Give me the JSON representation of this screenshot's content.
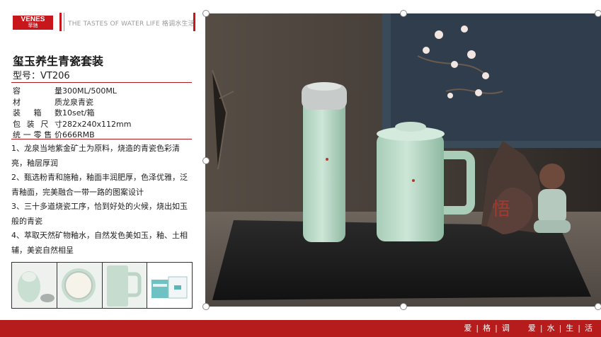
{
  "header": {
    "logo_text": "VENES",
    "logo_sub": "菲驰",
    "tagline": "THE TASTES OF WATER LIFE 格调水生活"
  },
  "product": {
    "title": "玺玉养生青瓷套装",
    "model": "型号：VT206",
    "specs": [
      {
        "label": "容量",
        "value": "300ML/500ML"
      },
      {
        "label": "材质",
        "value": "龙泉青瓷"
      },
      {
        "label": "装箱数",
        "value": "10set/箱"
      },
      {
        "label": "包装尺寸",
        "value": "282x240x112mm"
      },
      {
        "label": "统一零售价",
        "value": "666RMB"
      }
    ],
    "features": [
      "1、龙泉当地紫金矿土为原料，烧造的青瓷色彩清亮，釉层厚润",
      "2、甄选粉青和施釉，釉面丰润肥厚，色泽优雅，泛青釉面，完美融合一带一路的图案设计",
      "3、三十多道烧瓷工序，恰到好处的火候，烧出如玉般的青瓷",
      "4、萃取天然矿物釉水，自然发色美如玉，釉、土相辅，美瓷自然相呈"
    ]
  },
  "footer": {
    "slogan": [
      "爱",
      "格",
      "调",
      "爱",
      "水",
      "生",
      "活"
    ]
  },
  "colors": {
    "brand_red": "#c8161d",
    "footer_red": "#b71c1c",
    "celadon": "#b9d8c6"
  }
}
